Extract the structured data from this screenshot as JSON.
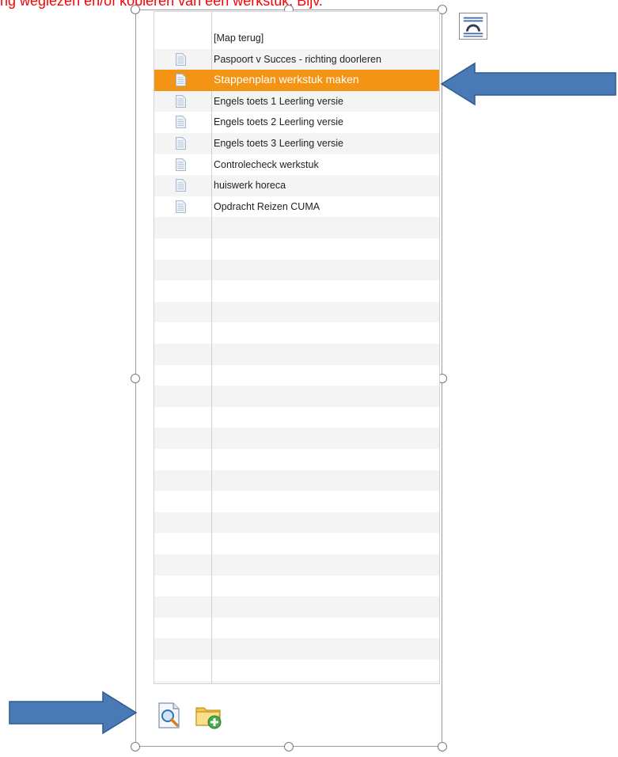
{
  "instruction_text": "ng weglezen en/of kopiëren van een werkstuk. Bijv.",
  "list": {
    "items": [
      {
        "label": "[Map terug]",
        "type": "folder-up",
        "selected": false
      },
      {
        "label": "Paspoort v Succes - richting doorleren",
        "type": "document",
        "selected": false
      },
      {
        "label": "Stappenplan werkstuk maken",
        "type": "document",
        "selected": true
      },
      {
        "label": "Engels toets 1 Leerling versie",
        "type": "document",
        "selected": false
      },
      {
        "label": "Engels toets 2 Leerling versie",
        "type": "document",
        "selected": false
      },
      {
        "label": "Engels toets 3 Leerling versie",
        "type": "document",
        "selected": false
      },
      {
        "label": "Controlecheck werkstuk",
        "type": "document",
        "selected": false
      },
      {
        "label": "huiswerk horeca",
        "type": "document",
        "selected": false
      },
      {
        "label": "Opdracht Reizen CUMA",
        "type": "document",
        "selected": false
      }
    ]
  },
  "toolbar": {
    "buttons": [
      {
        "name": "preview-document-button",
        "icon": "magnifier-document-icon"
      },
      {
        "name": "new-folder-button",
        "icon": "folder-add-icon"
      }
    ]
  },
  "layout_options_icon": "text-wrap-icon",
  "colors": {
    "selection": "#f39415",
    "arrow": "#4a7ab5",
    "instruction_text": "#ff0000"
  }
}
